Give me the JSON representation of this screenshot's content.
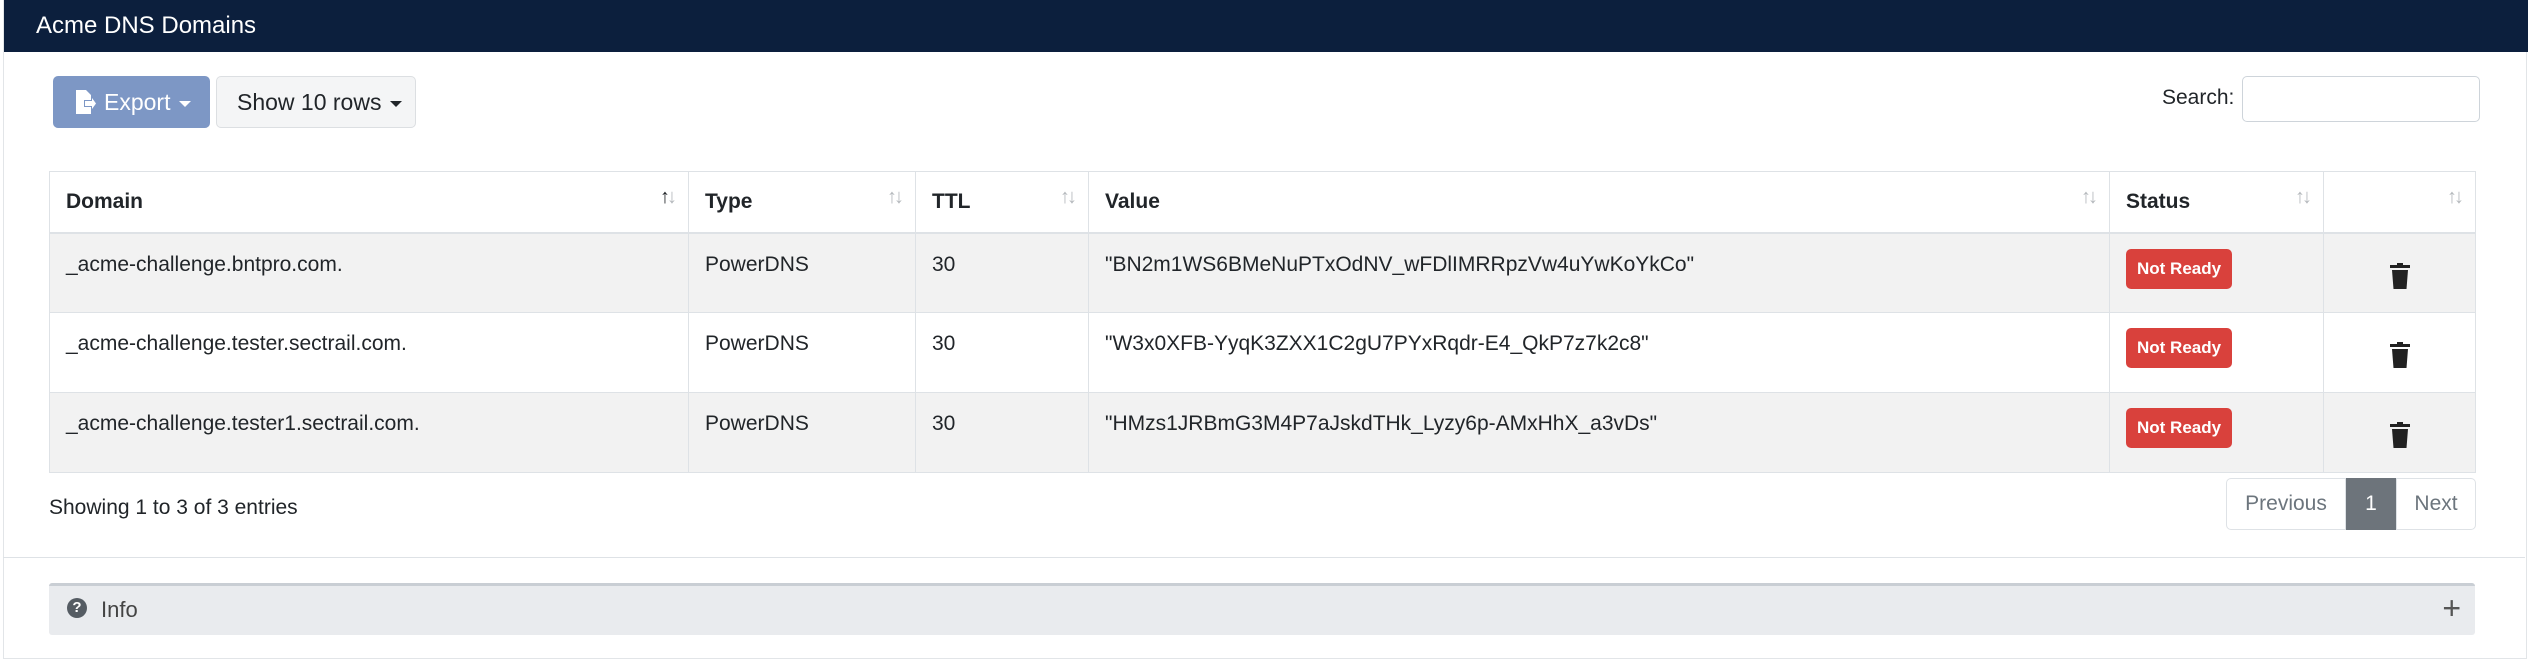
{
  "header": {
    "title": "Acme DNS Domains"
  },
  "toolbar": {
    "export_label": "Export",
    "rows_label": "Show 10 rows",
    "search_label": "Search:",
    "search_value": "",
    "search_placeholder": ""
  },
  "table": {
    "columns": [
      "Domain",
      "Type",
      "TTL",
      "Value",
      "Status",
      ""
    ],
    "rows": [
      {
        "domain": "_acme-challenge.bntpro.com.",
        "type": "PowerDNS",
        "ttl": "30",
        "value": "\"BN2m1WS6BMeNuPTxOdNV_wFDlIMRRpzVw4uYwKoYkCo\"",
        "status": "Not Ready"
      },
      {
        "domain": "_acme-challenge.tester.sectrail.com.",
        "type": "PowerDNS",
        "ttl": "30",
        "value": "\"W3x0XFB-YyqK3ZXX1C2gU7PYxRqdr-E4_QkP7z7k2c8\"",
        "status": "Not Ready"
      },
      {
        "domain": "_acme-challenge.tester1.sectrail.com.",
        "type": "PowerDNS",
        "ttl": "30",
        "value": "\"HMzs1JRBmG3M4P7aJskdTHk_Lyzy6p-AMxHhX_a3vDs\"",
        "status": "Not Ready"
      }
    ]
  },
  "footer": {
    "info_text": "Showing 1 to 3 of 3 entries",
    "previous": "Previous",
    "current_page": "1",
    "next": "Next"
  },
  "info_panel": {
    "label": "Info",
    "expand_symbol": "+"
  },
  "colors": {
    "header_bg": "#0c1f3d",
    "export_btn": "#7d97c5",
    "badge_danger": "#d9413c",
    "active_page": "#6d747b"
  },
  "icons": [
    "export-file-icon",
    "sort-icon",
    "trash-icon",
    "question-circle-icon",
    "plus-icon"
  ]
}
